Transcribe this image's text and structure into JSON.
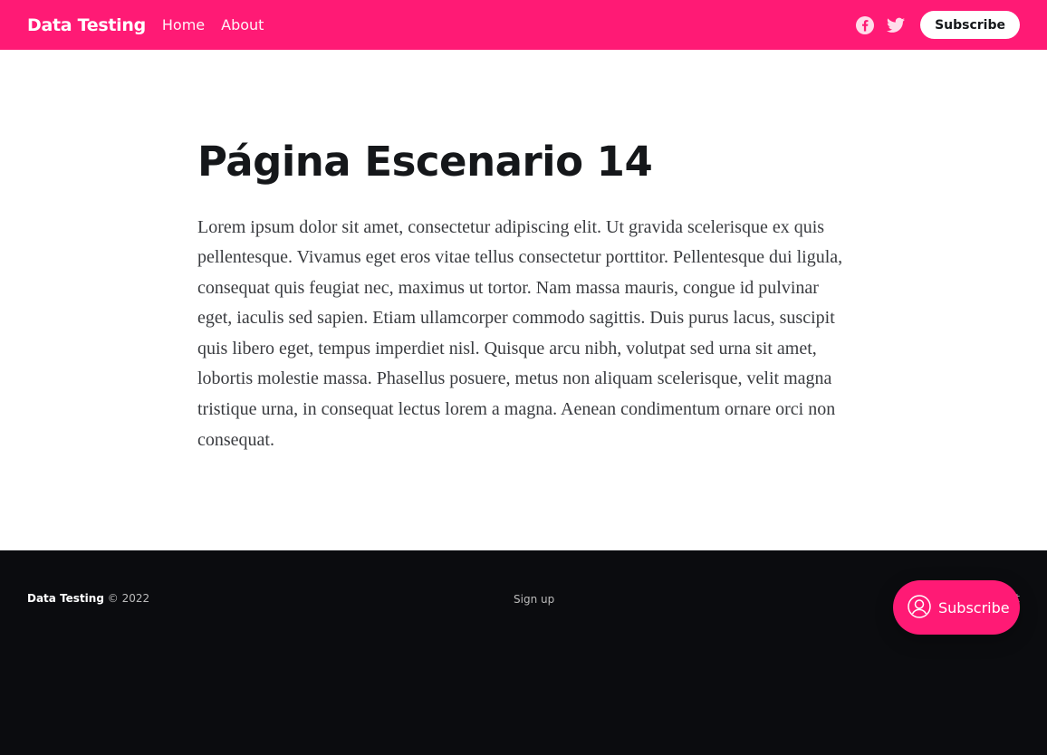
{
  "header": {
    "brand": "Data Testing",
    "nav": [
      "Home",
      "About"
    ],
    "social_icons": [
      "facebook-icon",
      "twitter-icon"
    ],
    "subscribe_label": "Subscribe",
    "background_color": "#ff1a75"
  },
  "main": {
    "title": "Página Escenario 14",
    "body": "Lorem ipsum dolor sit amet, consectetur adipiscing elit. Ut gravida scelerisque ex quis pellentesque. Vivamus eget eros vitae tellus consectetur porttitor. Pellentesque dui ligula, consequat quis feugiat nec, maximus ut tortor. Nam massa mauris, congue id pulvinar eget, iaculis sed sapien. Etiam ullamcorper commodo sagittis. Duis purus lacus, suscipit quis libero eget, tempus imperdiet nisl. Quisque arcu nibh, volutpat sed urna sit amet, lobortis molestie massa. Phasellus posuere, metus non aliquam scelerisque, velit magna tristique urna, in consequat lectus lorem a magna. Aenean condimentum ornare orci non consequat."
  },
  "footer": {
    "brand": "Data Testing",
    "copyright": " © 2022",
    "link": "Sign up",
    "right_link": "t",
    "background_color": "#0b0c0f"
  },
  "portal": {
    "label": "Subscribe",
    "icon": "user-circle-icon"
  }
}
